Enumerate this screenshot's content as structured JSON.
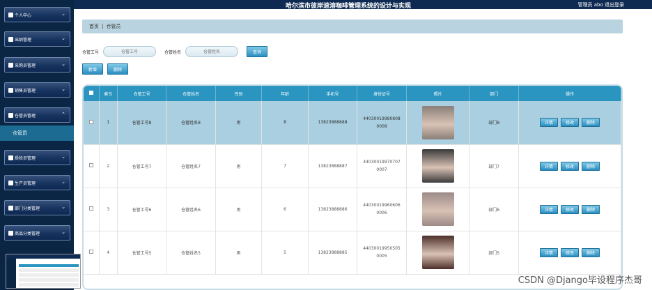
{
  "app": {
    "title": "哈尔滨市彼岸速溶咖啡管理系统的设计与实现",
    "user_label": "管理员 abo",
    "logout_label": "退出登录"
  },
  "sidebar": {
    "items": [
      {
        "label": "个人中心",
        "icon": "user-icon"
      },
      {
        "label": "出纳管理",
        "icon": "monitor-icon"
      },
      {
        "label": "采购员管理",
        "icon": "book-icon"
      },
      {
        "label": "销售员管理",
        "icon": "grid-icon"
      },
      {
        "label": "仓管员管理",
        "icon": "send-icon"
      },
      {
        "label": "质检员管理",
        "icon": "monitor-icon"
      },
      {
        "label": "生产员管理",
        "icon": "film-icon"
      },
      {
        "label": "部门分类管理",
        "icon": "grid-icon"
      },
      {
        "label": "商品分类管理",
        "icon": "book-icon"
      }
    ],
    "active_sub": "仓管员"
  },
  "breadcrumb": {
    "home": "首页",
    "sep": "|",
    "current": "仓管员"
  },
  "search": {
    "field1_label": "仓管工号",
    "field1_placeholder": "仓管工号",
    "field2_label": "仓管姓名",
    "field2_placeholder": "仓管姓名",
    "query_label": "查询"
  },
  "actions": {
    "add_label": "新增",
    "delete_label": "删除"
  },
  "table": {
    "headers": [
      "索引",
      "仓管工号",
      "仓管姓名",
      "性别",
      "年龄",
      "手机号",
      "身份证号",
      "照片",
      "部门",
      "操作"
    ],
    "rows": [
      {
        "index": "1",
        "code": "仓管工号8",
        "name": "仓管姓名8",
        "gender": "男",
        "age": "8",
        "phone": "13823888888",
        "id1": "44030019980808",
        "id2": "0008",
        "dept": "部门8",
        "photo_color": "#8a7f79",
        "selected": true
      },
      {
        "index": "2",
        "code": "仓管工号7",
        "name": "仓管姓名7",
        "gender": "男",
        "age": "7",
        "phone": "13823888887",
        "id1": "44030019970707",
        "id2": "0007",
        "dept": "部门7",
        "photo_color": "#3a3a3a",
        "selected": false
      },
      {
        "index": "3",
        "code": "仓管工号6",
        "name": "仓管姓名6",
        "gender": "男",
        "age": "6",
        "phone": "13823888886",
        "id1": "44030019960606",
        "id2": "0006",
        "dept": "部门6",
        "photo_color": "#9c8a88",
        "selected": false
      },
      {
        "index": "4",
        "code": "仓管工号5",
        "name": "仓管姓名5",
        "gender": "男",
        "age": "5",
        "phone": "13823888885",
        "id1": "44030019950505",
        "id2": "0005",
        "dept": "部门5",
        "photo_color": "#4d2f2a",
        "selected": false
      }
    ],
    "op_detail": "详情",
    "op_edit": "修改",
    "op_delete": "删除"
  },
  "watermark": "CSDN @Django毕设程序杰哥"
}
